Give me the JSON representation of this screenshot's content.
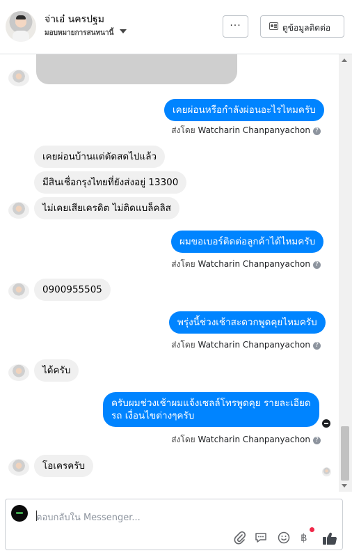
{
  "header": {
    "name": "จ่าเอ๋ นครปฐม",
    "assigned": "มอบหมายการสนทนานี้",
    "more_label": "···",
    "contact_label": "ดูข้อมูลติดต่อ"
  },
  "messages": {
    "m1": "เคยผ่อนหรือกำลังผ่อนอะไรไหมครับ",
    "m2": "เคยผ่อนบ้านแต่ตัดสดไปแล้ว",
    "m3": "มีสินเชื่อกรุงไทยที่ยังส่งอยู่ 13300",
    "m4": "ไม่เคยเสียเครดิต ไม่ติดแบล็คลิส",
    "m5": "ผมขอเบอร์ติดต่อลูกค้าได้ไหมครับ",
    "m6": "0900955505",
    "m7": "พรุ่งนี้ช่วงเช้าสะดวกพูดคุยไหมครับ",
    "m8": "ได้ครับ",
    "m9_line1": "ครับผมช่วงเช้าผมแจ้งเซลล์โทรพูดคุย รายละเอียด",
    "m9_line2": "รถ เงื่อนไขต่างๆครับ",
    "m10": "โอเครครับ"
  },
  "sent_by": {
    "prefix": "ส่งโดย",
    "agent": "Watcharin Chanpanyachon",
    "help": "?"
  },
  "composer": {
    "placeholder": "ตอบกลับใน Messenger...",
    "pay_symbol": "฿"
  },
  "colors": {
    "outgoing_bubble": "#0084ff",
    "incoming_bubble": "#f0f0f0",
    "notification_dot": "#f02849"
  }
}
